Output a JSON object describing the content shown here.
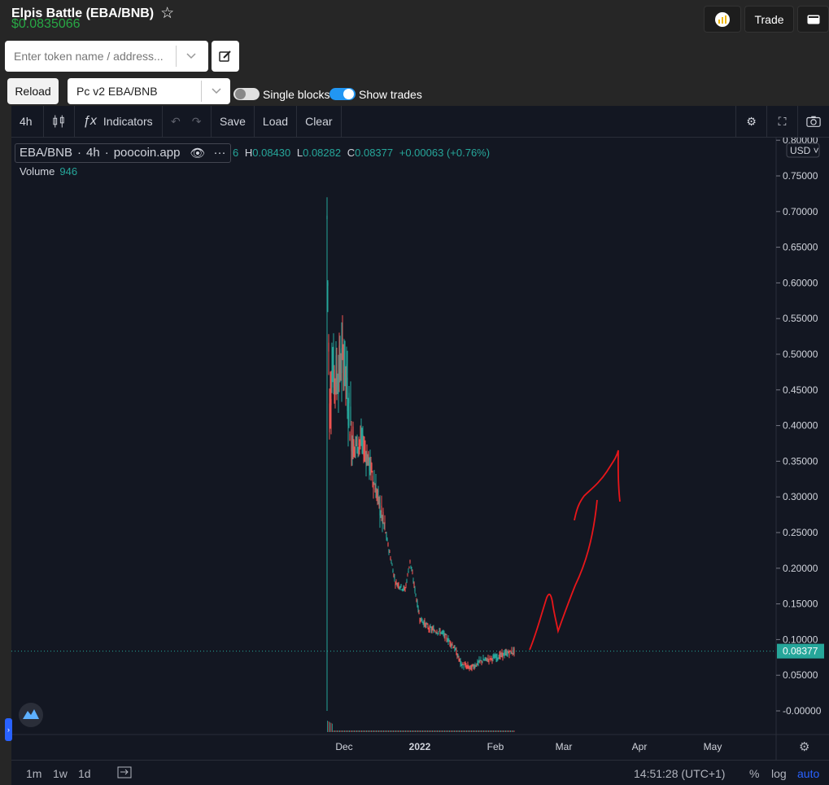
{
  "header": {
    "title": "Elpis Battle (EBA/BNB)",
    "price": "$0.0835066",
    "trade_label": "Trade"
  },
  "search": {
    "placeholder": "Enter token name / address..."
  },
  "controls": {
    "reload_label": "Reload",
    "pair_value": "Pc v2 EBA/BNB",
    "single_blocks_label": "Single blocks",
    "single_blocks_on": false,
    "show_trades_label": "Show trades",
    "show_trades_on": true
  },
  "toolbar": {
    "interval": "4h",
    "indicators_label": "Indicators",
    "save_label": "Save",
    "load_label": "Load",
    "clear_label": "Clear"
  },
  "legend": {
    "symbol": "EBA/BNB",
    "interval": "4h",
    "source": "poocoin.app",
    "ohlc_prefix": "6",
    "h_label": "H",
    "h_value": "0.08430",
    "l_label": "L",
    "l_value": "0.08282",
    "c_label": "C",
    "c_value": "0.08377",
    "change": "+0.00063 (+0.76%)",
    "volume_label": "Volume",
    "volume_value": "946"
  },
  "chart_data": {
    "type": "candlestick",
    "currency": "USD",
    "last_price": 0.08377,
    "x_ticks": [
      "Dec",
      "2022",
      "Feb",
      "Mar",
      "Apr",
      "May"
    ],
    "y_ticks": [
      "0.80000",
      "0.75000",
      "0.70000",
      "0.65000",
      "0.60000",
      "0.55000",
      "0.50000",
      "0.45000",
      "0.40000",
      "0.35000",
      "0.30000",
      "0.25000",
      "0.20000",
      "0.15000",
      "0.10000",
      "0.05000",
      "-0.00000"
    ],
    "ylim": [
      -0.03,
      0.8
    ],
    "series": [
      {
        "x": [
          "Nov 24",
          "Nov 25",
          "Nov 26",
          "Nov 28",
          "Dec 1",
          "Dec 3",
          "Dec 5",
          "Dec 8",
          "Dec 12",
          "Dec 16",
          "Dec 18",
          "Dec 22",
          "Dec 26",
          "Dec 28",
          "Jan 1",
          "Jan 5",
          "Jan 10",
          "Jan 15",
          "Jan 18",
          "Jan 22",
          "Jan 26",
          "Feb 1",
          "Feb 5",
          "Feb 9"
        ],
        "y": [
          0.69,
          0.42,
          0.48,
          0.47,
          0.5,
          0.42,
          0.37,
          0.38,
          0.34,
          0.28,
          0.25,
          0.18,
          0.17,
          0.21,
          0.13,
          0.115,
          0.11,
          0.09,
          0.065,
          0.06,
          0.07,
          0.075,
          0.08,
          0.084
        ]
      }
    ],
    "annotation": "hand-drawn red upward arrow"
  },
  "bottom": {
    "ranges": [
      "1m",
      "1w",
      "1d"
    ],
    "time": "14:51:28 (UTC+1)",
    "percent_label": "%",
    "log_label": "log",
    "auto_label": "auto"
  },
  "colors": {
    "up": "#26a69a",
    "down": "#ef5350",
    "price_green": "#28a745",
    "toggle_on": "#2196f3",
    "annotation": "#e8161a"
  }
}
